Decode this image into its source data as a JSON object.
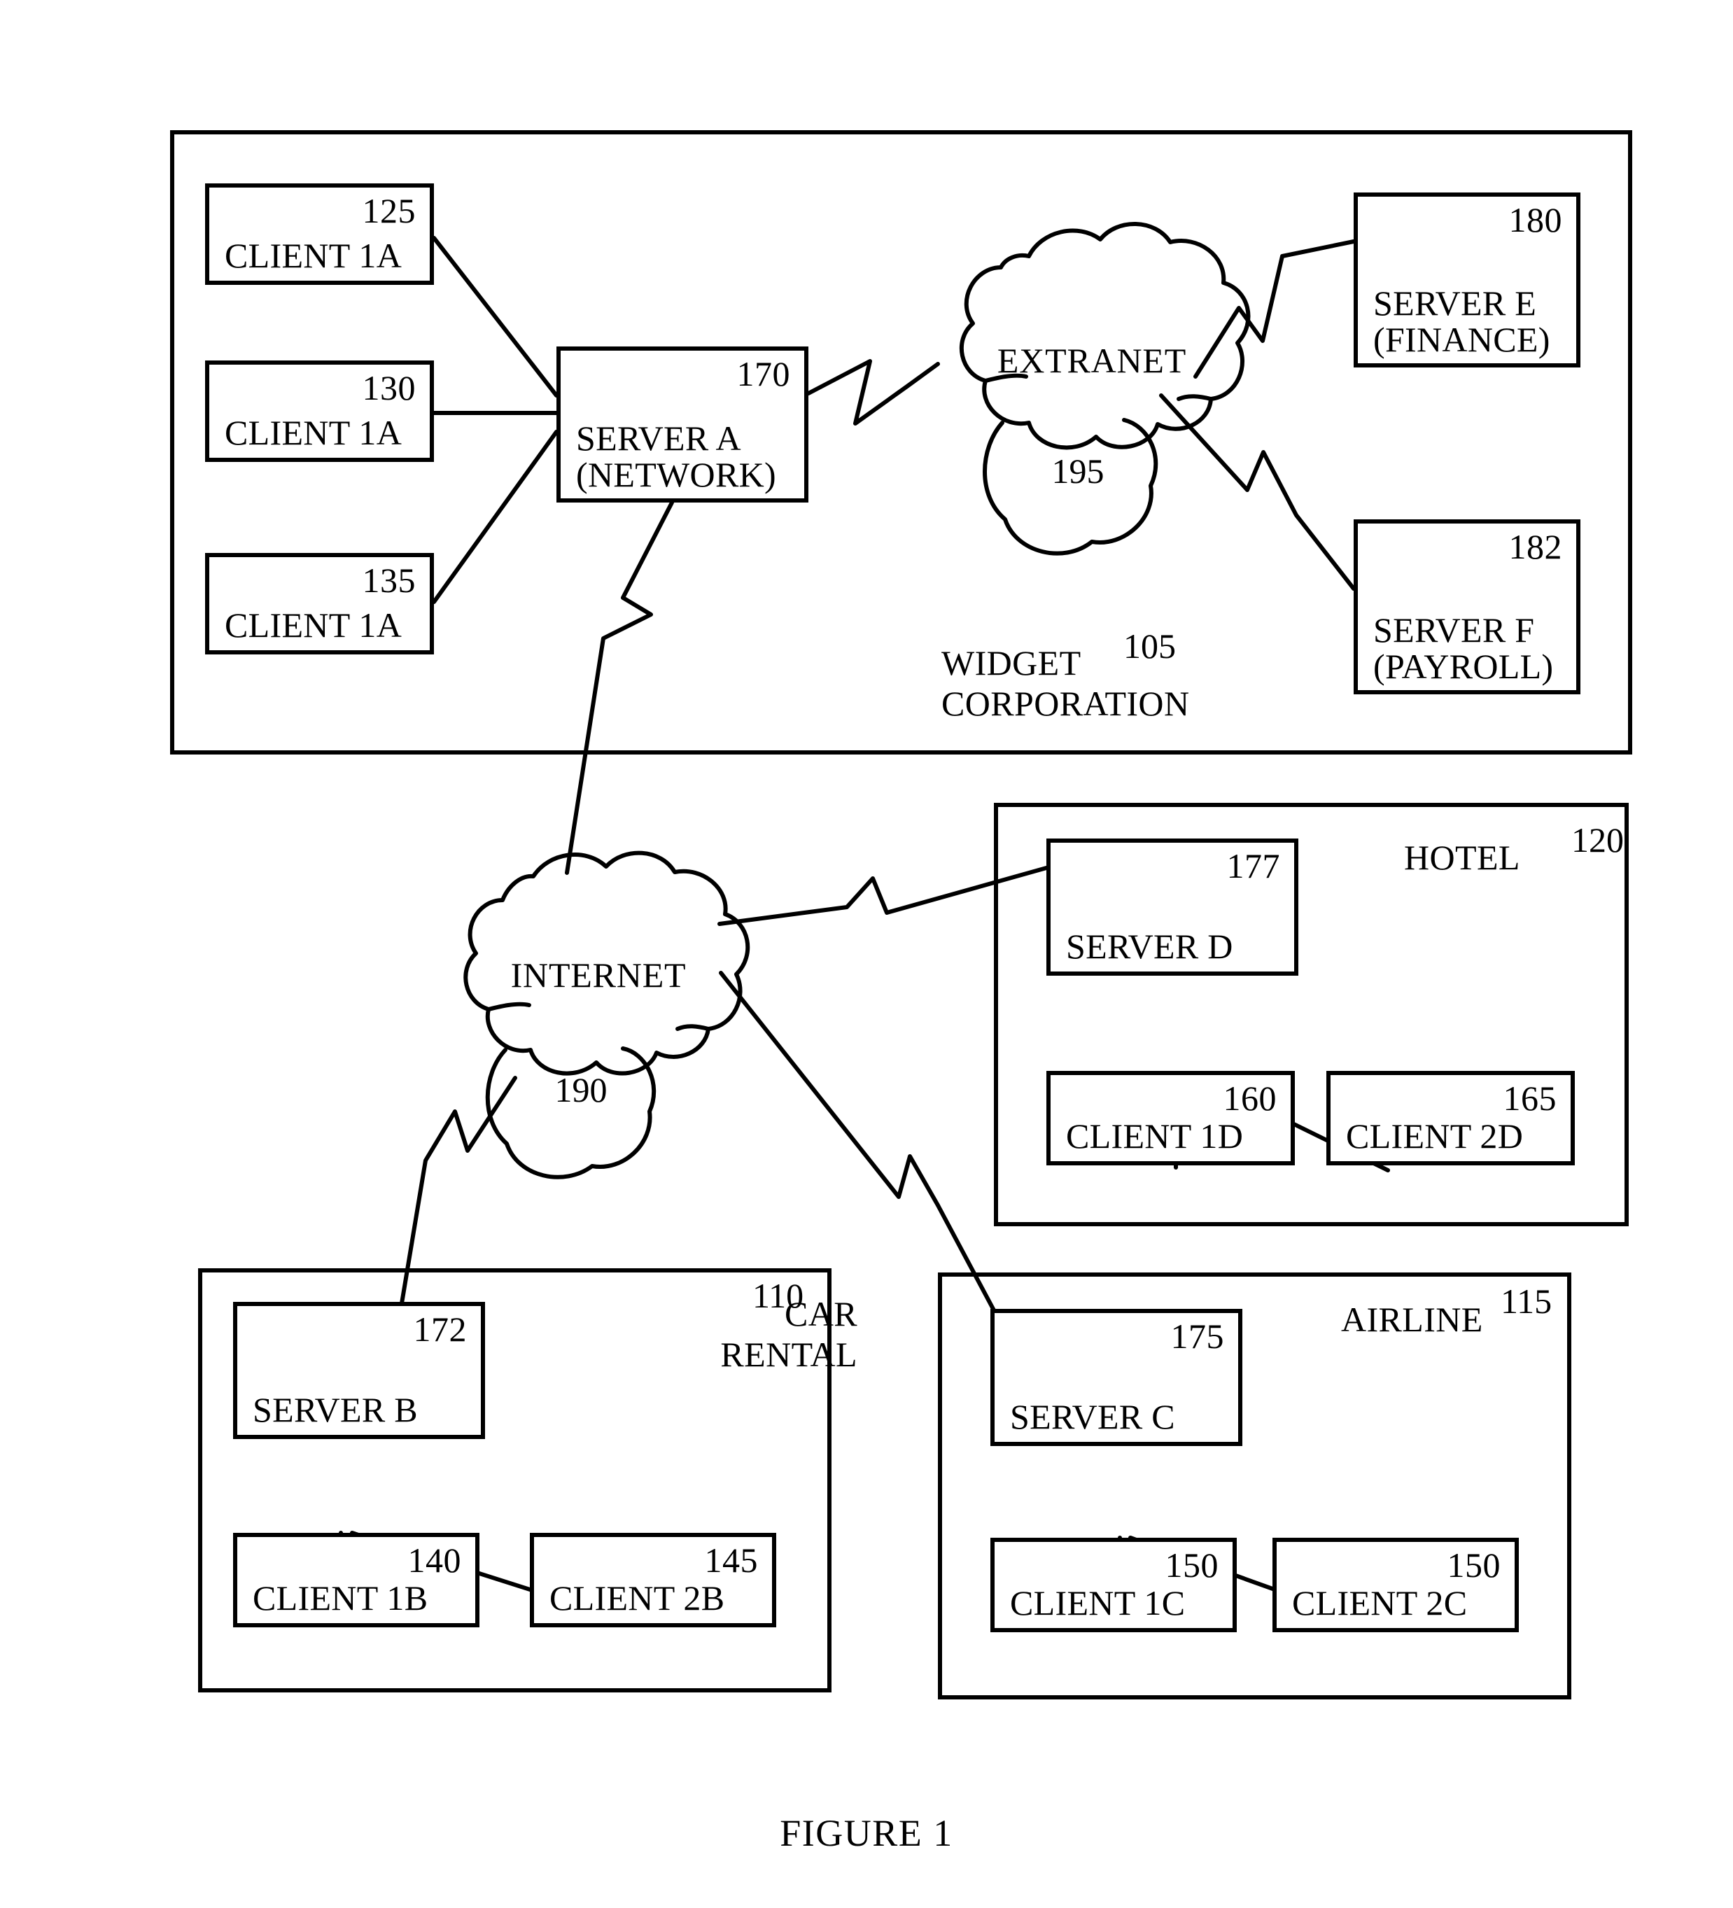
{
  "figure": {
    "caption": "FIGURE 1",
    "type": "patent-network-diagram"
  },
  "groups": [
    {
      "id": "widget-corporation",
      "title": "WIDGET\nCORPORATION",
      "ref": "105"
    },
    {
      "id": "hotel",
      "title": "HOTEL",
      "ref": "120"
    },
    {
      "id": "car-rental",
      "title": "CAR\nRENTAL",
      "ref": "110"
    },
    {
      "id": "airline",
      "title": "AIRLINE",
      "ref": "115"
    }
  ],
  "nodes": {
    "client_1a_125": {
      "ref": "125",
      "label": "CLIENT 1A"
    },
    "client_1a_130": {
      "ref": "130",
      "label": "CLIENT 1A"
    },
    "client_1a_135": {
      "ref": "135",
      "label": "CLIENT 1A"
    },
    "server_a": {
      "ref": "170",
      "label": "SERVER A\n(NETWORK)"
    },
    "server_e": {
      "ref": "180",
      "label": "SERVER E\n(FINANCE)"
    },
    "server_f": {
      "ref": "182",
      "label": "SERVER F\n(PAYROLL)"
    },
    "server_d": {
      "ref": "177",
      "label": "SERVER D"
    },
    "client_1d": {
      "ref": "160",
      "label": "CLIENT 1D"
    },
    "client_2d": {
      "ref": "165",
      "label": "CLIENT 2D"
    },
    "server_b": {
      "ref": "172",
      "label": "SERVER B"
    },
    "client_1b": {
      "ref": "140",
      "label": "CLIENT 1B"
    },
    "client_2b": {
      "ref": "145",
      "label": "CLIENT 2B"
    },
    "server_c": {
      "ref": "175",
      "label": "SERVER C"
    },
    "client_1c": {
      "ref": "150",
      "label": "CLIENT 1C"
    },
    "client_2c": {
      "ref": "150",
      "label": "CLIENT 2C"
    }
  },
  "clouds": {
    "extranet": {
      "name": "EXTRANET",
      "ref": "195"
    },
    "internet": {
      "name": "INTERNET",
      "ref": "190"
    }
  },
  "colors": {
    "ink": "#000000",
    "paper": "#ffffff"
  }
}
